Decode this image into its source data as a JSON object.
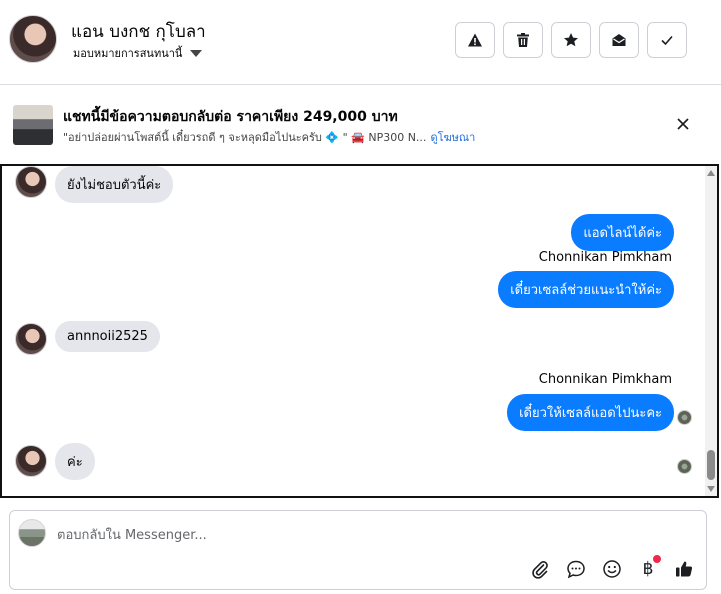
{
  "header": {
    "contact_name": "แอน บงกช กุโบลา",
    "assign_label": "มอบหมายการสนทนานี้",
    "buttons": [
      {
        "name": "report-button",
        "icon": "warning-icon"
      },
      {
        "name": "delete-button",
        "icon": "trash-icon"
      },
      {
        "name": "star-button",
        "icon": "star-icon"
      },
      {
        "name": "mark-unread-button",
        "icon": "envelope-open-icon"
      },
      {
        "name": "mark-done-button",
        "icon": "check-icon"
      }
    ]
  },
  "ad": {
    "title": "แชทนี้มีข้อความตอบกลับต่อ ราคาเพียง 249,000 บาท",
    "subtitle": "\"อย่าปล่อยผ่านโพสต์นี้ เดี๋ยวรถดี ๆ จะหลุดมือไปนะครับ 💠 \" 🚘 NP300 N...",
    "link": "ดูโฆษณา"
  },
  "chat": {
    "messages": [
      {
        "direction": "in",
        "text": "ยังไม่ชอบตัวนี้ค่ะ"
      },
      {
        "direction": "out",
        "text": "แอดไลน์ได้ค่ะ"
      },
      {
        "direction": "out",
        "sender": "Chonnikan Pimkham",
        "text": "เดี๋ยวเซลล์ช่วยแนะนำให้ค่ะ"
      },
      {
        "direction": "in",
        "text": "annnoii2525"
      },
      {
        "direction": "out",
        "sender": "Chonnikan Pimkham",
        "text": "เดี๋ยวให้เซลล์แอดไปนะคะ"
      },
      {
        "direction": "in",
        "text": "ค่ะ"
      }
    ]
  },
  "composer": {
    "placeholder": "ตอบกลับใน Messenger...",
    "tools": [
      "paperclip-icon",
      "chat-bubble-icon",
      "smiley-icon",
      "baht-icon",
      "thumbs-up-icon"
    ],
    "baht_symbol": "฿"
  },
  "colors": {
    "outgoing_bubble": "#0a7cff",
    "incoming_bubble": "#e4e6eb",
    "link": "#216fdb",
    "notification_dot": "#f02849"
  }
}
